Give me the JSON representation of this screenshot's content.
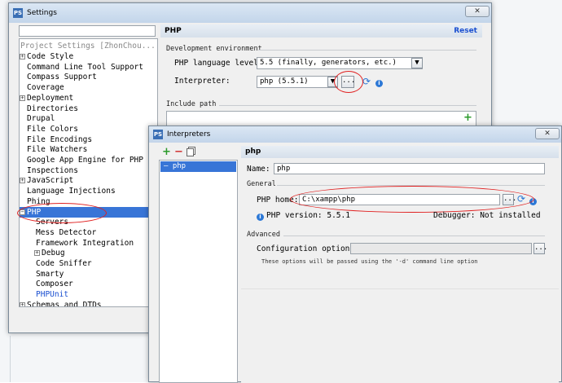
{
  "settings": {
    "title": "Settings",
    "search_value": "",
    "tree_header": "Project Settings [ZhonChou...",
    "tree": [
      {
        "label": "Code Style",
        "exp": "+",
        "indent": 0
      },
      {
        "label": "Command Line Tool Support",
        "exp": "",
        "indent": 0
      },
      {
        "label": "Compass Support",
        "exp": "",
        "indent": 0
      },
      {
        "label": "Coverage",
        "exp": "",
        "indent": 0
      },
      {
        "label": "Deployment",
        "exp": "+",
        "indent": 0
      },
      {
        "label": "Directories",
        "exp": "",
        "indent": 0
      },
      {
        "label": "Drupal",
        "exp": "",
        "indent": 0
      },
      {
        "label": "File Colors",
        "exp": "",
        "indent": 0
      },
      {
        "label": "File Encodings",
        "exp": "",
        "indent": 0
      },
      {
        "label": "File Watchers",
        "exp": "",
        "indent": 0
      },
      {
        "label": "Google App Engine for PHP",
        "exp": "",
        "indent": 0
      },
      {
        "label": "Inspections",
        "exp": "",
        "indent": 0
      },
      {
        "label": "JavaScript",
        "exp": "+",
        "indent": 0
      },
      {
        "label": "Language Injections",
        "exp": "",
        "indent": 0
      },
      {
        "label": "Phing",
        "exp": "",
        "indent": 0
      },
      {
        "label": "PHP",
        "exp": "-",
        "indent": 0,
        "selected": true
      },
      {
        "label": "Servers",
        "exp": "",
        "indent": 1
      },
      {
        "label": "Mess Detector",
        "exp": "",
        "indent": 1
      },
      {
        "label": "Framework Integration",
        "exp": "",
        "indent": 1
      },
      {
        "label": "Debug",
        "exp": "+",
        "indent": 1
      },
      {
        "label": "Code Sniffer",
        "exp": "",
        "indent": 1
      },
      {
        "label": "Smarty",
        "exp": "",
        "indent": 1
      },
      {
        "label": "Composer",
        "exp": "",
        "indent": 1
      },
      {
        "label": "PHPUnit",
        "exp": "",
        "indent": 1,
        "link": true
      },
      {
        "label": "Schemas and DTDs",
        "exp": "+",
        "indent": 0
      }
    ],
    "php_header": "PHP",
    "reset_label": "Reset",
    "dev_env_label": "Development environment",
    "language_level_label": "PHP language level:",
    "language_level_value": "5.5 (finally, generators, etc.)",
    "interpreter_label": "Interpreter:",
    "interpreter_value": "php (5.5.1)",
    "include_path_label": "Include path",
    "browse_label": "...",
    "add_label": "+"
  },
  "interpreters": {
    "title": "Interpreters",
    "add_label": "+",
    "remove_label": "−",
    "list_item": "php",
    "header": "php",
    "name_label": "Name:",
    "name_value": "php",
    "general_label": "General",
    "php_home_label": "PHP home:",
    "php_home_value": "C:\\xampp\\php",
    "php_version_label": "PHP version: 5.5.1",
    "debugger_label": "Debugger: Not installed",
    "advanced_label": "Advanced",
    "config_options_label": "Configuration options:",
    "config_options_value": "",
    "hint": "These options will be passed using the '-d' command line option",
    "browse_label": "..."
  },
  "colors": {
    "accent": "#1a4fd0",
    "selection": "#3875d7",
    "highlight": "#e02020"
  }
}
